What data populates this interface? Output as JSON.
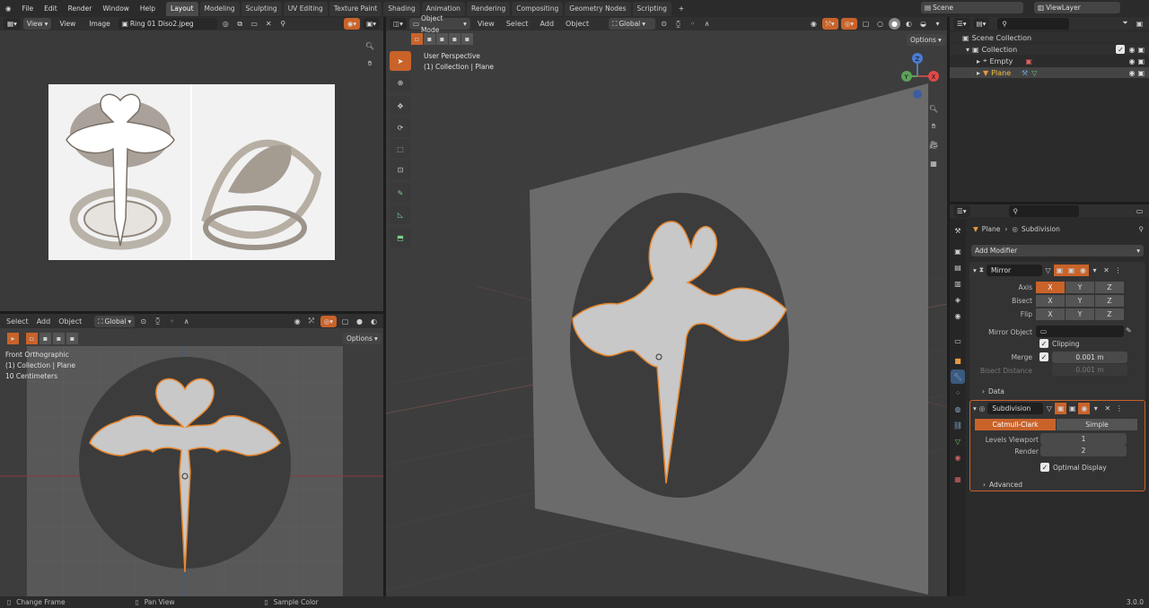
{
  "topbar": {
    "menus": [
      "File",
      "Edit",
      "Render",
      "Window",
      "Help"
    ],
    "workspaces": [
      "Layout",
      "Modeling",
      "Sculpting",
      "UV Editing",
      "Texture Paint",
      "Shading",
      "Animation",
      "Rendering",
      "Compositing",
      "Geometry Nodes",
      "Scripting"
    ],
    "active_workspace": "Layout",
    "add_tab": "+",
    "scene": "Scene",
    "view_layer": "ViewLayer"
  },
  "image_editor": {
    "view_label": "View",
    "menus": [
      "View",
      "Image"
    ],
    "image_name": "Ring 01 Diso2.jpeg"
  },
  "front_view": {
    "menus": [
      "Select",
      "Add",
      "Object"
    ],
    "orientation": "Global",
    "options": "Options",
    "overlay": [
      "Front Orthographic",
      "(1) Collection | Plane",
      "10 Centimeters"
    ]
  },
  "main_view": {
    "mode": "Object Mode",
    "menus": [
      "View",
      "Select",
      "Add",
      "Object"
    ],
    "orientation": "Global",
    "options": "Options",
    "overlay": [
      "User Perspective",
      "(1) Collection | Plane"
    ],
    "gizmo_axes": [
      "Z",
      "Y",
      "X"
    ]
  },
  "outliner": {
    "scene_collection": "Scene Collection",
    "collection": "Collection",
    "items": [
      "Empty",
      "Plane"
    ]
  },
  "properties": {
    "breadcrumb_object": "Plane",
    "breadcrumb_modifier": "Subdivision",
    "add_modifier": "Add Modifier",
    "mirror": {
      "name": "Mirror",
      "axis_label": "Axis",
      "bisect_label": "Bisect",
      "flip_label": "Flip",
      "xyz": [
        "X",
        "Y",
        "Z"
      ],
      "mirror_object_label": "Mirror Object",
      "clipping_label": "Clipping",
      "merge_label": "Merge",
      "merge_value": "0.001 m",
      "bisect_distance_label": "Bisect Distance",
      "bisect_distance_value": "0.001 m",
      "data_label": "Data"
    },
    "subdivision": {
      "name": "Subdivision",
      "catmull": "Catmull-Clark",
      "simple": "Simple",
      "levels_label": "Levels Viewport",
      "levels_value": "1",
      "render_label": "Render",
      "render_value": "2",
      "optimal_label": "Optimal Display",
      "advanced_label": "Advanced"
    }
  },
  "statusbar": {
    "items": [
      "Change Frame",
      "Pan View",
      "Sample Color"
    ],
    "version": "3.0.0"
  },
  "colors": {
    "accent": "#c9632a",
    "bg": "#1d1d1d",
    "panel": "#303030",
    "viewport": "#3d3d3d"
  }
}
